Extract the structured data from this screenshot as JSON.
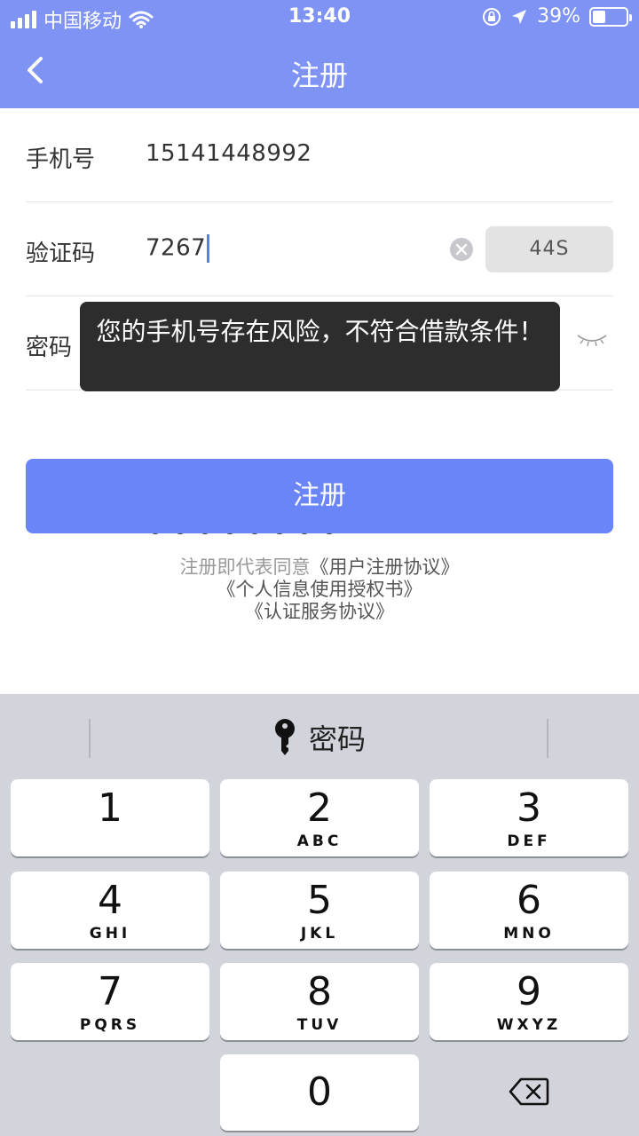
{
  "status": {
    "carrier": "中国移动",
    "time": "13:40",
    "battery_text": "39%",
    "battery_level": 0.39
  },
  "nav": {
    "title": "注册"
  },
  "form": {
    "phone_label": "手机号",
    "phone_value": "15141448992",
    "code_label": "验证码",
    "code_value": "7267",
    "code_button": "44S",
    "password_label": "密码"
  },
  "toast": {
    "message": "您的手机号存在风险，不符合借款条件！"
  },
  "submit_label": "注册",
  "agreement": {
    "prefix": "注册即代表同意",
    "link1": "《用户注册协议》",
    "link2": "《个人信息使用授权书》",
    "link3": "《认证服务协议》"
  },
  "keyboard": {
    "hint": "密码",
    "keys": [
      {
        "num": "1",
        "letters": ""
      },
      {
        "num": "2",
        "letters": "ABC"
      },
      {
        "num": "3",
        "letters": "DEF"
      },
      {
        "num": "4",
        "letters": "GHI"
      },
      {
        "num": "5",
        "letters": "JKL"
      },
      {
        "num": "6",
        "letters": "MNO"
      },
      {
        "num": "7",
        "letters": "PQRS"
      },
      {
        "num": "8",
        "letters": "TUV"
      },
      {
        "num": "9",
        "letters": "WXYZ"
      },
      {
        "num": "0",
        "letters": ""
      }
    ]
  },
  "colors": {
    "primary": "#6a85f8",
    "header": "#7f93f4",
    "keyboard_bg": "#d1d5db"
  }
}
